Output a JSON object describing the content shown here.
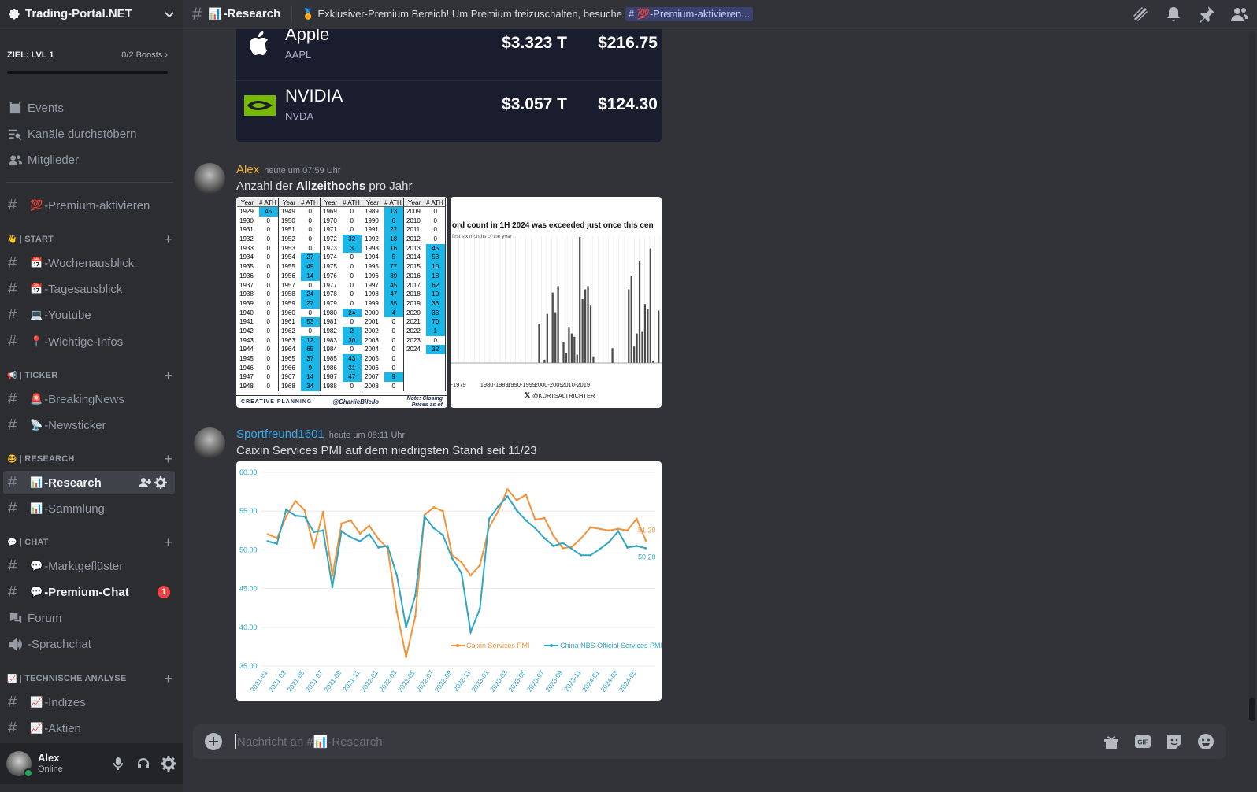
{
  "server": {
    "name": "Trading-Portal.NET",
    "boost_goal": "ZIEL: LVL 1",
    "boost_count": "0/2 Boosts"
  },
  "nav": {
    "events": "Events",
    "browse": "Kanäle durchstöbern",
    "members": "Mitglieder",
    "premium": "-Premium-aktivieren"
  },
  "categories": {
    "start": {
      "label": "| START",
      "channels": [
        "-Wochenausblick",
        "-Tagesausblick",
        "-Youtube",
        "-Wichtige-Infos"
      ]
    },
    "ticker": {
      "label": "| TICKER",
      "channels": [
        "-BreakingNews",
        "-Newsticker"
      ]
    },
    "research": {
      "label": "| RESEARCH",
      "channels": [
        "-Research",
        "-Sammlung"
      ]
    },
    "chat": {
      "label": "| CHAT",
      "channels": [
        "-Marktgeflüster",
        "-Premium-Chat",
        "Forum",
        "-Sprachchat"
      ],
      "badge": "1"
    },
    "ta": {
      "label": "| TECHNISCHE ANALYSE",
      "channels": [
        "-Indizes",
        "-Aktien"
      ]
    }
  },
  "user": {
    "name": "Alex",
    "status": "Online"
  },
  "topbar": {
    "channel": "-Research",
    "topic": "Exklusiver-Premium Bereich! Um Premium freizuschalten, besuche",
    "topic_link": "-Premium-aktivieren..."
  },
  "stocks": [
    {
      "name": "Apple",
      "ticker": "AAPL",
      "cap": "$3.323 T",
      "price": "$216.75"
    },
    {
      "name": "NVIDIA",
      "ticker": "NVDA",
      "cap": "$3.057 T",
      "price": "$124.30"
    }
  ],
  "messages": [
    {
      "author": "Alex",
      "author_color": "#f0b232",
      "time": "heute um 07:59 Uhr",
      "text_before": "Anzahl der ",
      "text_bold": "Allzeithochs",
      "text_after": " pro Jahr"
    },
    {
      "author": "Sportfreund1601",
      "author_color": "#3ba6e8",
      "time": "heute um 08:11 Uhr",
      "text": "Caixin Services PMI auf dem niedrigsten Stand seit 11/23"
    }
  ],
  "ath_table": {
    "headers": [
      "Year",
      "# ATH"
    ],
    "columns": [
      [
        [
          1929,
          45
        ],
        [
          1930,
          0
        ],
        [
          1931,
          0
        ],
        [
          1932,
          0
        ],
        [
          1933,
          0
        ],
        [
          1934,
          0
        ],
        [
          1935,
          0
        ],
        [
          1936,
          0
        ],
        [
          1937,
          0
        ],
        [
          1938,
          0
        ],
        [
          1939,
          0
        ],
        [
          1940,
          0
        ],
        [
          1941,
          0
        ],
        [
          1942,
          0
        ],
        [
          1943,
          0
        ],
        [
          1944,
          0
        ],
        [
          1945,
          0
        ],
        [
          1946,
          0
        ],
        [
          1947,
          0
        ],
        [
          1948,
          0
        ]
      ],
      [
        [
          1949,
          0
        ],
        [
          1950,
          0
        ],
        [
          1951,
          0
        ],
        [
          1952,
          0
        ],
        [
          1953,
          0
        ],
        [
          1954,
          27
        ],
        [
          1955,
          49
        ],
        [
          1956,
          14
        ],
        [
          1957,
          0
        ],
        [
          1958,
          24
        ],
        [
          1959,
          27
        ],
        [
          1960,
          0
        ],
        [
          1961,
          53
        ],
        [
          1962,
          0
        ],
        [
          1963,
          12
        ],
        [
          1964,
          65
        ],
        [
          1965,
          37
        ],
        [
          1966,
          9
        ],
        [
          1967,
          14
        ],
        [
          1968,
          34
        ]
      ],
      [
        [
          1969,
          0
        ],
        [
          1970,
          0
        ],
        [
          1971,
          0
        ],
        [
          1972,
          32
        ],
        [
          1973,
          3
        ],
        [
          1974,
          0
        ],
        [
          1975,
          0
        ],
        [
          1976,
          0
        ],
        [
          1977,
          0
        ],
        [
          1978,
          0
        ],
        [
          1979,
          0
        ],
        [
          1980,
          24
        ],
        [
          1981,
          0
        ],
        [
          1982,
          2
        ],
        [
          1983,
          30
        ],
        [
          1984,
          0
        ],
        [
          1985,
          43
        ],
        [
          1986,
          31
        ],
        [
          1987,
          47
        ],
        [
          1988,
          0
        ]
      ],
      [
        [
          1989,
          13
        ],
        [
          1990,
          6
        ],
        [
          1991,
          22
        ],
        [
          1992,
          18
        ],
        [
          1993,
          16
        ],
        [
          1994,
          5
        ],
        [
          1995,
          77
        ],
        [
          1996,
          39
        ],
        [
          1997,
          45
        ],
        [
          1998,
          47
        ],
        [
          1999,
          35
        ],
        [
          2000,
          4
        ],
        [
          2001,
          0
        ],
        [
          2002,
          0
        ],
        [
          2003,
          0
        ],
        [
          2004,
          0
        ],
        [
          2005,
          0
        ],
        [
          2006,
          0
        ],
        [
          2007,
          9
        ],
        [
          2008,
          0
        ]
      ],
      [
        [
          2009,
          0
        ],
        [
          2010,
          0
        ],
        [
          2011,
          0
        ],
        [
          2012,
          0
        ],
        [
          2013,
          45
        ],
        [
          2014,
          53
        ],
        [
          2015,
          10
        ],
        [
          2016,
          18
        ],
        [
          2017,
          62
        ],
        [
          2018,
          19
        ],
        [
          2019,
          36
        ],
        [
          2020,
          33
        ],
        [
          2021,
          70
        ],
        [
          2022,
          1
        ],
        [
          2023,
          0
        ],
        [
          2024,
          32
        ]
      ]
    ],
    "footer_left": "CREATIVE PLANNING",
    "footer_mid": "@CharlieBilello",
    "footer_right": "Note: Closing Prices as of"
  },
  "record_chart": {
    "title": "ord count in 1H 2024 was exceeded just once this cen",
    "subtitle": "first six months of the year",
    "x_labels": [
      "0-1979",
      "1980-1989",
      "1990-1999",
      "2000-2009",
      "2010-2019"
    ],
    "credit": "@KURTSALTRICHTER",
    "values": [
      0,
      0,
      0,
      0,
      0,
      0,
      0,
      0,
      0,
      0,
      0,
      0,
      0,
      0,
      0,
      0,
      0,
      0,
      0,
      0,
      0,
      0,
      0,
      0,
      0,
      0,
      0,
      0,
      0,
      0,
      0,
      24,
      0,
      2,
      30,
      0,
      43,
      31,
      47,
      0,
      13,
      6,
      22,
      18,
      16,
      5,
      77,
      39,
      45,
      47,
      35,
      4,
      0,
      0,
      0,
      0,
      0,
      0,
      9,
      0,
      0,
      0,
      0,
      0,
      45,
      53,
      10,
      18,
      62,
      19,
      36,
      33,
      70,
      1,
      0,
      32
    ]
  },
  "chart_data": {
    "type": "line",
    "title": "",
    "xlabel": "",
    "ylabel": "",
    "ylim": [
      35,
      60
    ],
    "yticks": [
      "60.00",
      "55.00",
      "50.00",
      "45.00",
      "40.00",
      "35.00"
    ],
    "x": [
      "2021-01",
      "2021-02",
      "2021-03",
      "2021-04",
      "2021-05",
      "2021-06",
      "2021-07",
      "2021-08",
      "2021-09",
      "2021-10",
      "2021-11",
      "2021-12",
      "2022-01",
      "2022-02",
      "2022-03",
      "2022-04",
      "2022-05",
      "2022-06",
      "2022-07",
      "2022-08",
      "2022-09",
      "2022-10",
      "2022-11",
      "2022-12",
      "2023-01",
      "2023-02",
      "2023-03",
      "2023-04",
      "2023-05",
      "2023-06",
      "2023-07",
      "2023-08",
      "2023-09",
      "2023-10",
      "2023-11",
      "2023-12",
      "2024-01",
      "2024-02",
      "2024-03",
      "2024-04",
      "2024-05",
      "2024-06"
    ],
    "x_tick_labels": [
      "2021-01",
      "2021-03",
      "2021-05",
      "2021-07",
      "2021-09",
      "2021-11",
      "2022-01",
      "2022-03",
      "2022-05",
      "2022-07",
      "2022-09",
      "2022-11",
      "2023-01",
      "2023-03",
      "2023-05",
      "2023-07",
      "2023-09",
      "2023-11",
      "2024-01",
      "2024-03",
      "2024-05"
    ],
    "series": [
      {
        "name": "Caixin Services PMI",
        "color": "#f2933a",
        "end_label": "51.20",
        "values": [
          52.0,
          51.5,
          54.3,
          56.3,
          55.1,
          50.3,
          54.9,
          46.7,
          53.4,
          53.8,
          52.1,
          53.1,
          51.4,
          50.2,
          42.0,
          36.2,
          41.4,
          54.5,
          55.5,
          55.0,
          49.3,
          48.4,
          46.7,
          48.0,
          52.9,
          55.0,
          57.8,
          56.4,
          57.1,
          53.9,
          54.1,
          51.8,
          50.2,
          50.4,
          51.5,
          52.9,
          52.7,
          52.5,
          52.7,
          52.5,
          54.0,
          51.2
        ]
      },
      {
        "name": "China NBS Official Services PMI",
        "color": "#2ea6c4",
        "end_label": "50.20",
        "values": [
          51.1,
          50.8,
          55.2,
          54.4,
          54.3,
          52.3,
          52.5,
          45.2,
          52.4,
          51.6,
          51.1,
          52.0,
          50.3,
          50.5,
          46.7,
          40.0,
          44.1,
          54.3,
          52.8,
          51.9,
          48.9,
          47.0,
          39.4,
          42.4,
          54.0,
          55.6,
          56.9,
          55.1,
          53.8,
          52.8,
          51.5,
          50.5,
          50.9,
          50.1,
          49.3,
          49.3,
          50.1,
          51.0,
          52.4,
          50.3,
          50.5,
          50.2
        ]
      }
    ],
    "legend": "bottom-right"
  },
  "composer": {
    "placeholder": "Nachricht an #",
    "placeholder_channel": "-Research"
  }
}
